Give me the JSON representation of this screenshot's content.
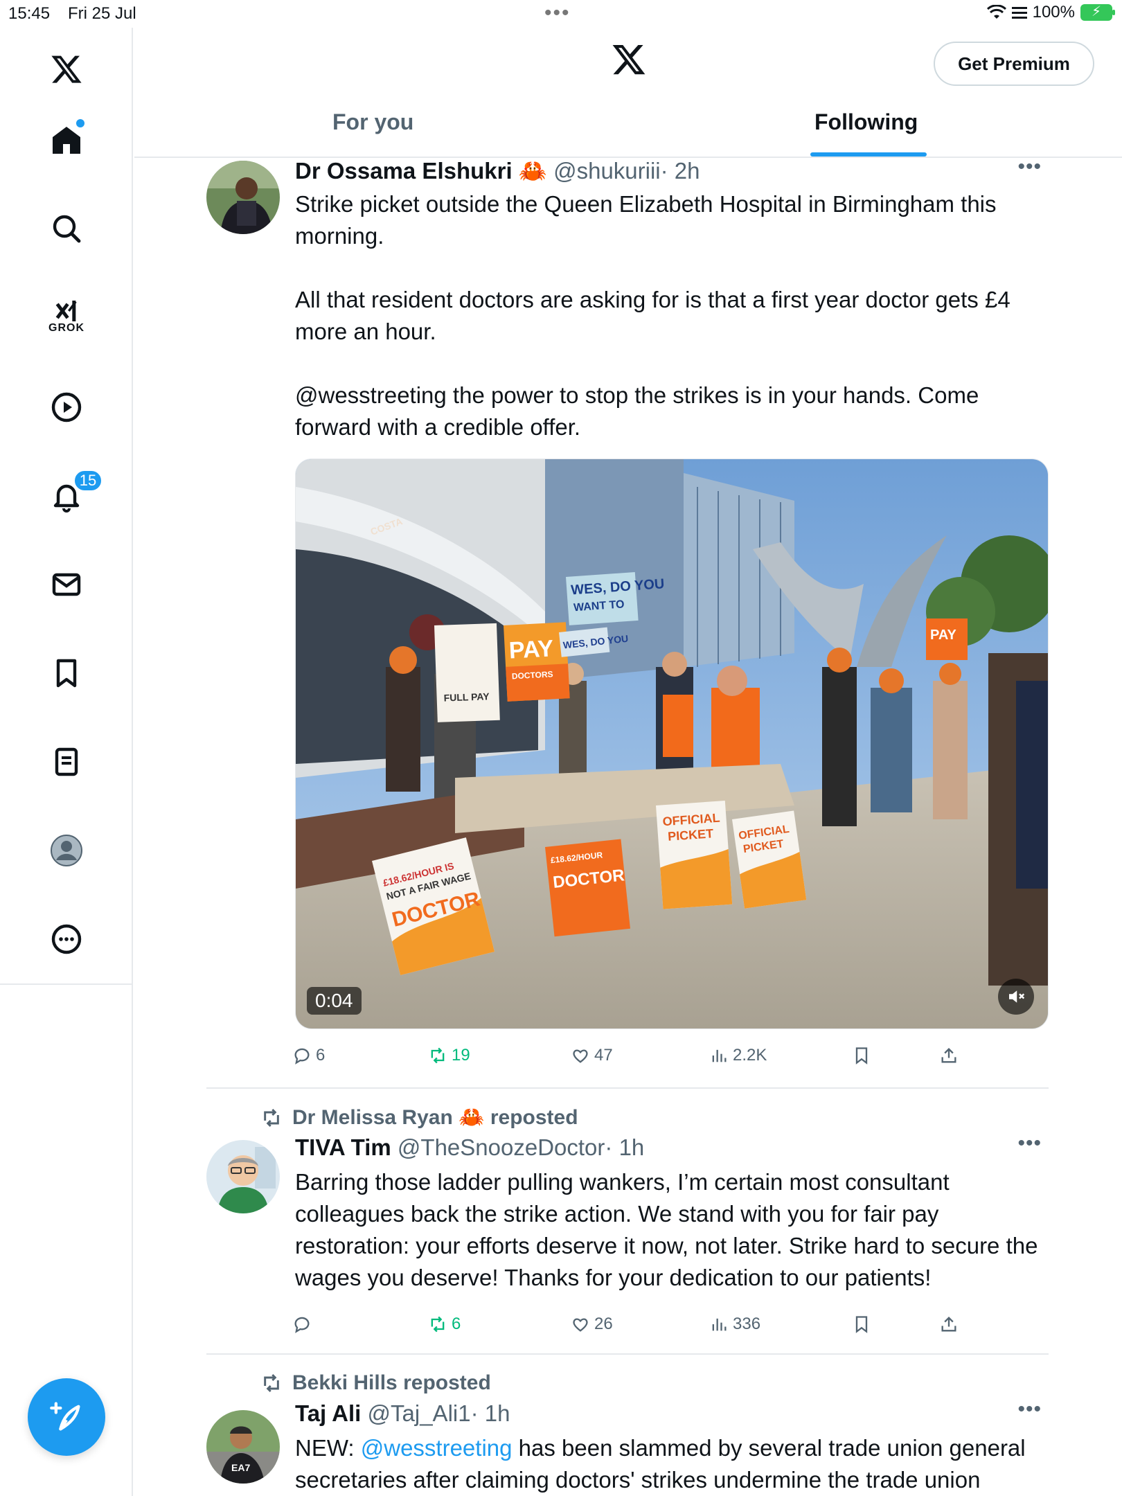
{
  "status_bar": {
    "time": "15:45",
    "date": "Fri 25 Jul",
    "battery": "100%"
  },
  "header": {
    "premium_label": "Get Premium",
    "tabs": [
      {
        "label": "For you",
        "active": false
      },
      {
        "label": "Following",
        "active": true
      }
    ]
  },
  "sidebar": {
    "grok_label": "GROK",
    "notifications_count": "15"
  },
  "posts": [
    {
      "name": "Dr Ossama Elshukri",
      "emoji": "🦀",
      "handle": "@shukuriii",
      "time": "· 2h",
      "text": "Strike picket outside the Queen Elizabeth Hospital in Birmingham this morning.\n\nAll that resident doctors are asking for is that a first year doctor gets £4 more an hour.\n\n@wesstreeting the power to stop the strikes is in your hands. Come forward with a credible offer.",
      "video_duration": "0:04",
      "replies": "6",
      "reposts": "19",
      "likes": "47",
      "views": "2.2K",
      "sign_texts": [
        "PAY",
        "DOCTORS",
        "OFFICIAL PICKET",
        "£18.62/HOUR IS NOT A FAIR WAGE FOR A RESIDENT DOCTOR",
        "WES, DO YOU WANT TO MY BLEEP?",
        "FULL PAY",
        "COSTA"
      ]
    },
    {
      "repost_by": "Dr Melissa Ryan",
      "repost_emoji": "🦀",
      "repost_suffix": "reposted",
      "name": "TIVA Tim",
      "handle": "@TheSnoozeDoctor",
      "time": "· 1h",
      "text": "Barring those ladder pulling wankers, I’m certain most consultant colleagues back the strike action. We stand with you for fair pay restoration: your efforts deserve it now, not later. Strike hard to secure the wages you deserve! Thanks for your dedication to our patients!",
      "replies": "",
      "reposts": "6",
      "likes": "26",
      "views": "336"
    },
    {
      "repost_by": "Bekki Hills",
      "repost_suffix": "reposted",
      "name": "Taj Ali",
      "handle": "@Taj_Ali1",
      "time": "· 1h",
      "text_prefix": "NEW: ",
      "text_link": "@wesstreeting",
      "text_rest": " has been slammed by several trade union general secretaries after claiming doctors' strikes undermine the trade union",
      "avatar_shirt_text": "EA7"
    }
  ]
}
